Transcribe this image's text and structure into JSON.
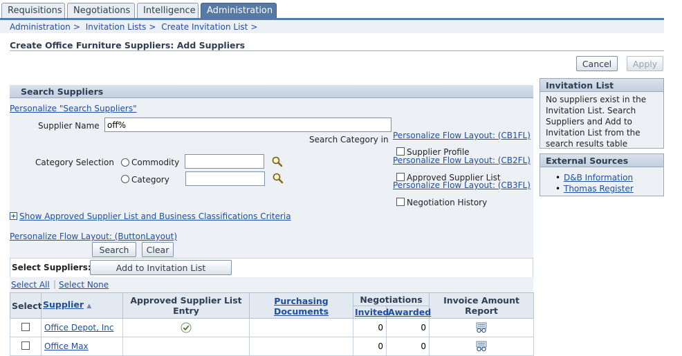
{
  "tabs": [
    "Requisitions",
    "Negotiations",
    "Intelligence",
    "Administration"
  ],
  "breadcrumbs": [
    "Administration",
    "Invitation Lists",
    "Create Invitation List"
  ],
  "breadcrumb_sep": ">",
  "page_title": "Create Office Furniture Suppliers: Add Suppliers",
  "actions": {
    "cancel": "Cancel",
    "apply": "Apply"
  },
  "search": {
    "header": "Search Suppliers",
    "personalize": "Personalize \"Search Suppliers\"",
    "supplier_name_label": "Supplier Name",
    "supplier_name_value": "off%",
    "search_category_in": "Search Category in",
    "category_selection_label": "Category Selection",
    "commodity_label": "Commodity",
    "category_label": "Category",
    "flow1": "Personalize Flow Layout: (CB1FL)",
    "supplier_profile": "Supplier Profile",
    "flow2": "Personalize Flow Layout: (CB2FL)",
    "approved_supplier_list": "Approved Supplier List",
    "flow3": "Personalize Flow Layout: (CB3FL)",
    "negotiation_history": "Negotiation History",
    "show_asl": "Show Approved Supplier List and Business Classifications Criteria",
    "flow_button": "Personalize Flow Layout: (ButtonLayout)",
    "search_btn": "Search",
    "clear_btn": "Clear"
  },
  "invitation_list": {
    "header": "Invitation List",
    "text": "No suppliers exist in the Invitation List. Search Suppliers and Add to Invitation List from the search results table"
  },
  "external_sources": {
    "header": "External Sources",
    "links": [
      "D&B Information",
      "Thomas Register"
    ]
  },
  "results": {
    "select_suppliers_label": "Select Suppliers:",
    "add_btn": "Add to Invitation List",
    "select_all": "Select All",
    "select_none": "Select None",
    "columns": {
      "select": "Select",
      "supplier": "Supplier",
      "asl_line1": "Approved Supplier List",
      "asl_line2": "Entry",
      "purchasing_docs": "Purchasing Documents",
      "negotiations": "Negotiations",
      "invited": "Invited",
      "awarded": "Awarded",
      "invoice_line1": "Invoice Amount",
      "invoice_line2": "Report"
    },
    "rows": [
      {
        "supplier": "Office Depot, Inc",
        "asl": true,
        "invited": "0",
        "awarded": "0"
      },
      {
        "supplier": "Office Max",
        "asl": false,
        "invited": "0",
        "awarded": "0"
      }
    ]
  },
  "colors": {
    "tab_active": "#567aa5",
    "link": "#1f4ea1",
    "panel_bg": "#edf1f6"
  }
}
